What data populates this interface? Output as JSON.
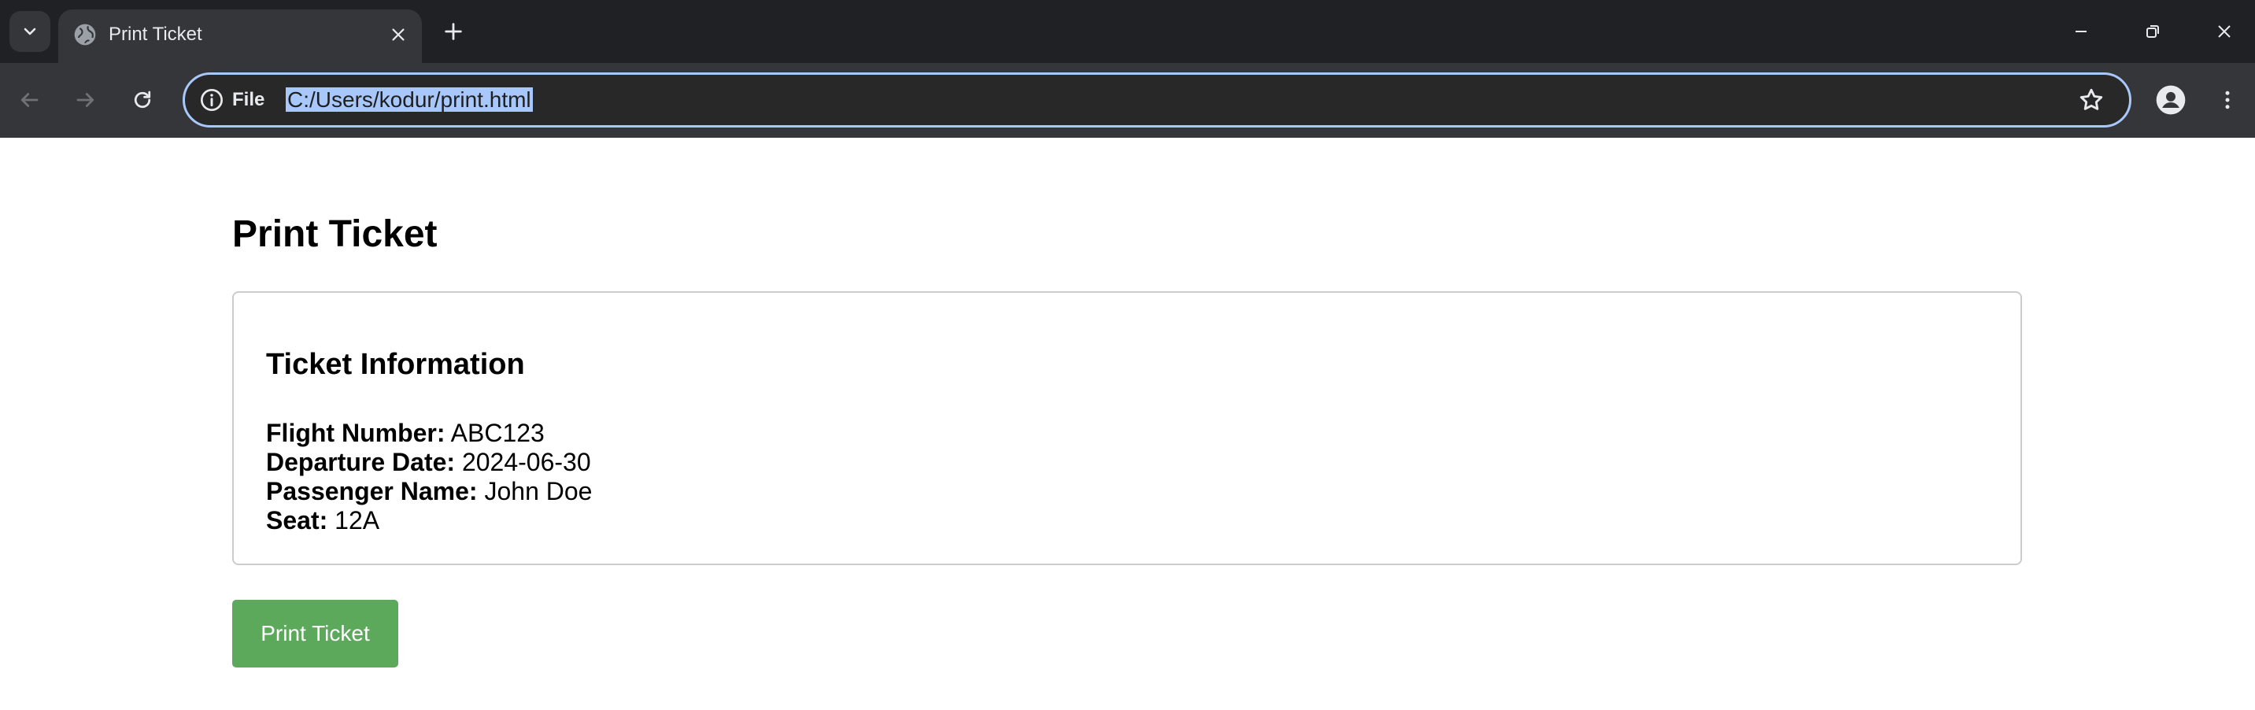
{
  "browser": {
    "tab": {
      "title": "Print Ticket"
    },
    "omnibox": {
      "scheme_label": "File",
      "url": "C:/Users/kodur/print.html"
    }
  },
  "page": {
    "title": "Print Ticket",
    "card": {
      "heading": "Ticket Information",
      "fields": [
        {
          "label": "Flight Number:",
          "value": "ABC123"
        },
        {
          "label": "Departure Date:",
          "value": "2024-06-30"
        },
        {
          "label": "Passenger Name:",
          "value": "John Doe"
        },
        {
          "label": "Seat:",
          "value": "12A"
        }
      ]
    },
    "print_button_label": "Print Ticket",
    "colors": {
      "button": "#5ca95c",
      "omnibox_border": "#a8c7fa"
    }
  }
}
